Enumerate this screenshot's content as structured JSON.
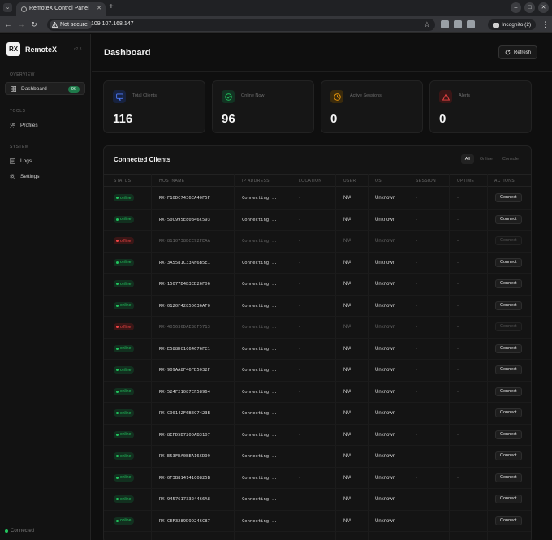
{
  "browser": {
    "tab_title": "RemoteX Control Panel",
    "security_label": "Not secure",
    "url": "109.107.168.147",
    "profile_label": "Incognito (2)"
  },
  "sidebar": {
    "brand_logo": "RX",
    "brand_name": "RemoteX",
    "version": "v2.3",
    "sections": [
      {
        "title": "OVERVIEW",
        "items": [
          {
            "label": "Dashboard",
            "badge": "96",
            "icon": "grid-icon",
            "active": true
          }
        ]
      },
      {
        "title": "TOOLS",
        "items": [
          {
            "label": "Profiles",
            "icon": "users-icon"
          }
        ]
      },
      {
        "title": "SYSTEM",
        "items": [
          {
            "label": "Logs",
            "icon": "logs-icon"
          },
          {
            "label": "Settings",
            "icon": "gear-icon"
          }
        ]
      }
    ],
    "footer_status": "Connected"
  },
  "header": {
    "title": "Dashboard",
    "refresh_label": "Refresh"
  },
  "stats": [
    {
      "label": "Total Clients",
      "value": "116",
      "icon": "monitor-icon",
      "color": "#4f7cff"
    },
    {
      "label": "Online Now",
      "value": "96",
      "icon": "check-circle-icon",
      "color": "#22c55e"
    },
    {
      "label": "Active Sessions",
      "value": "0",
      "icon": "clock-icon",
      "color": "#f59e0b"
    },
    {
      "label": "Alerts",
      "value": "0",
      "icon": "alert-triangle-icon",
      "color": "#ef4444"
    }
  ],
  "clients": {
    "title": "Connected Clients",
    "filters": [
      "All",
      "Online",
      "Console"
    ],
    "active_filter": "All",
    "columns": [
      "STATUS",
      "HOSTNAME",
      "IP ADDRESS",
      "LOCATION",
      "USER",
      "OS",
      "SESSION",
      "UPTIME",
      "ACTIONS"
    ],
    "connect_label": "Connect",
    "rows": [
      {
        "status": "online",
        "hostname": "RX-F10DC7436EA40F5F",
        "ip": "Connecting ...",
        "location": "-",
        "user": "N/A",
        "os": "Unknown",
        "session": "-",
        "uptime": "-"
      },
      {
        "status": "online",
        "hostname": "RX-50C995E80846C593",
        "ip": "Connecting ...",
        "location": "-",
        "user": "N/A",
        "os": "Unknown",
        "session": "-",
        "uptime": "-"
      },
      {
        "status": "offline",
        "hostname": "RX-8110738BCE92FEAA",
        "ip": "Connecting ...",
        "location": "-",
        "user": "N/A",
        "os": "Unknown",
        "session": "-",
        "uptime": "-"
      },
      {
        "status": "online",
        "hostname": "RX-3A5581C33AF6B5E1",
        "ip": "Connecting ...",
        "location": "-",
        "user": "N/A",
        "os": "Unknown",
        "session": "-",
        "uptime": "-"
      },
      {
        "status": "online",
        "hostname": "RX-15077D4B3ED26FD6",
        "ip": "Connecting ...",
        "location": "-",
        "user": "N/A",
        "os": "Unknown",
        "session": "-",
        "uptime": "-"
      },
      {
        "status": "online",
        "hostname": "RX-0120F4285D636AF0",
        "ip": "Connecting ...",
        "location": "-",
        "user": "N/A",
        "os": "Unknown",
        "session": "-",
        "uptime": "-"
      },
      {
        "status": "offline",
        "hostname": "RX-405636DAE38F5713",
        "ip": "Connecting ...",
        "location": "-",
        "user": "N/A",
        "os": "Unknown",
        "session": "-",
        "uptime": "-"
      },
      {
        "status": "online",
        "hostname": "RX-E588DC1C64676FC1",
        "ip": "Connecting ...",
        "location": "-",
        "user": "N/A",
        "os": "Unknown",
        "session": "-",
        "uptime": "-"
      },
      {
        "status": "online",
        "hostname": "RX-909AA8F46FD5032F",
        "ip": "Connecting ...",
        "location": "-",
        "user": "N/A",
        "os": "Unknown",
        "session": "-",
        "uptime": "-"
      },
      {
        "status": "online",
        "hostname": "RX-524F21087EF58964",
        "ip": "Connecting ...",
        "location": "-",
        "user": "N/A",
        "os": "Unknown",
        "session": "-",
        "uptime": "-"
      },
      {
        "status": "online",
        "hostname": "RX-C90142F6BEC7423B",
        "ip": "Connecting ...",
        "location": "-",
        "user": "N/A",
        "os": "Unknown",
        "session": "-",
        "uptime": "-"
      },
      {
        "status": "online",
        "hostname": "RX-8EFD5D720DAB31D7",
        "ip": "Connecting ...",
        "location": "-",
        "user": "N/A",
        "os": "Unknown",
        "session": "-",
        "uptime": "-"
      },
      {
        "status": "online",
        "hostname": "RX-E53FDA0BEA16CD99",
        "ip": "Connecting ...",
        "location": "-",
        "user": "N/A",
        "os": "Unknown",
        "session": "-",
        "uptime": "-"
      },
      {
        "status": "online",
        "hostname": "RX-0F3B814141C0825B",
        "ip": "Connecting ...",
        "location": "-",
        "user": "N/A",
        "os": "Unknown",
        "session": "-",
        "uptime": "-"
      },
      {
        "status": "online",
        "hostname": "RX-94576173324466A8",
        "ip": "Connecting ...",
        "location": "-",
        "user": "N/A",
        "os": "Unknown",
        "session": "-",
        "uptime": "-"
      },
      {
        "status": "online",
        "hostname": "RX-CEF3289D9D246C87",
        "ip": "Connecting ...",
        "location": "-",
        "user": "N/A",
        "os": "Unknown",
        "session": "-",
        "uptime": "-"
      }
    ]
  },
  "colors": {
    "online": "#22c55e",
    "online_bg": "#12301f",
    "offline": "#ef4444",
    "offline_bg": "#3a1616"
  }
}
